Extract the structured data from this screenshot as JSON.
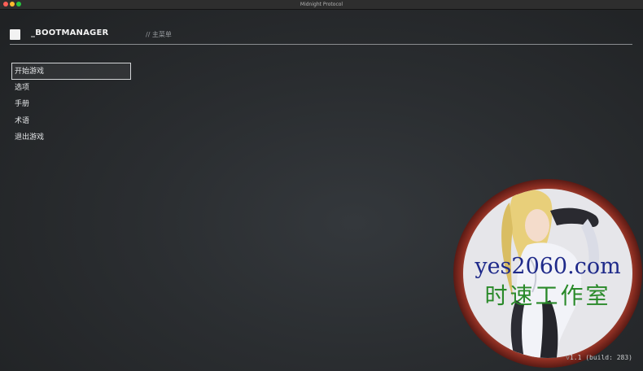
{
  "window": {
    "title": "Midnight Protocol"
  },
  "header": {
    "app_name": "_BOOTMANAGER",
    "section": "// 主菜单"
  },
  "menu": {
    "selected_index": 0,
    "items": [
      {
        "label": "开始游戏"
      },
      {
        "label": "选项"
      },
      {
        "label": "手册"
      },
      {
        "label": "术语"
      },
      {
        "label": "退出游戏"
      }
    ]
  },
  "watermark": {
    "line1": "yes2060.com",
    "line2": "时速工作室"
  },
  "footer": {
    "version_prefix": "v",
    "version": "1.1 (build: 283)"
  },
  "colors": {
    "accent": "#f2f2f2",
    "background": "#2a2d30",
    "watermark_ring": "#9e3a2a",
    "watermark_text_blue": "#1f2a8a",
    "watermark_text_green": "#2a8a2a"
  }
}
